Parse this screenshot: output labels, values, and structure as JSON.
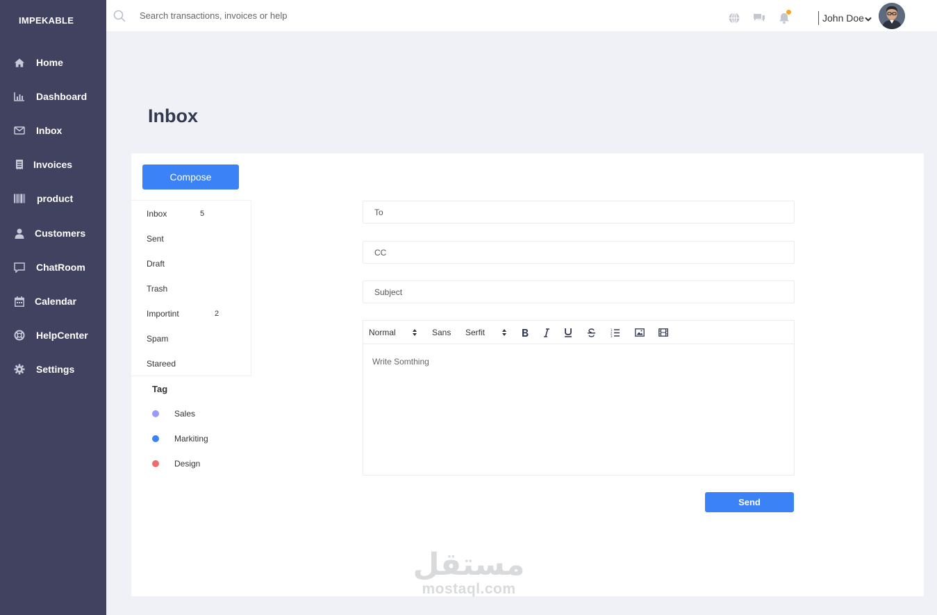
{
  "brand": "IMPEKABLE",
  "sidebar": {
    "items": [
      {
        "label": "Home",
        "icon": "home-icon"
      },
      {
        "label": "Dashboard",
        "icon": "chart-icon"
      },
      {
        "label": "Inbox",
        "icon": "envelope-icon"
      },
      {
        "label": "Invoices",
        "icon": "receipt-icon"
      },
      {
        "label": "product",
        "icon": "barcode-icon"
      },
      {
        "label": "Customers",
        "icon": "user-icon"
      },
      {
        "label": "ChatRoom",
        "icon": "chat-icon"
      },
      {
        "label": "Calendar",
        "icon": "calendar-icon"
      },
      {
        "label": "HelpCenter",
        "icon": "lifebuoy-icon"
      },
      {
        "label": "Settings",
        "icon": "gear-icon"
      }
    ]
  },
  "topbar": {
    "search_placeholder": "Search transactions, invoices or help",
    "user_name": "John Doe",
    "notification_color": "#f5a623"
  },
  "page": {
    "title": "Inbox"
  },
  "mail": {
    "compose_label": "Compose",
    "folders": [
      {
        "label": "Inbox",
        "count": "5"
      },
      {
        "label": "Sent",
        "count": ""
      },
      {
        "label": "Draft",
        "count": ""
      },
      {
        "label": "Trash",
        "count": ""
      },
      {
        "label": "Importint",
        "count": "2"
      },
      {
        "label": "Spam",
        "count": ""
      },
      {
        "label": "Stareed",
        "count": ""
      }
    ],
    "tag_title": "Tag",
    "tags": [
      {
        "label": "Sales",
        "color": "#9b9cf7"
      },
      {
        "label": "Markiting",
        "color": "#3b82f6"
      },
      {
        "label": "Design",
        "color": "#f06b6b"
      }
    ],
    "form": {
      "to_placeholder": "To",
      "cc_placeholder": "CC",
      "subject_placeholder": "Subject",
      "editor_placeholder": "Write Somthing",
      "send_label": "Send"
    },
    "toolbar": {
      "header_select": "Normal",
      "font_select_1": "Sans",
      "font_select_2": "Serfit"
    }
  },
  "colors": {
    "sidebar": "#414160",
    "accent": "#3b82f6"
  },
  "watermark": {
    "arabic": "مستقل",
    "latin": "mostaql.com"
  }
}
